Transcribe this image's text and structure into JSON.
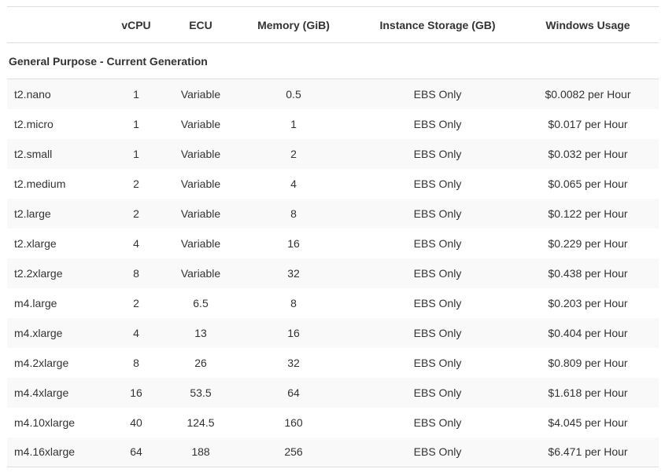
{
  "table": {
    "headers": {
      "name": "",
      "vcpu": "vCPU",
      "ecu": "ECU",
      "memory": "Memory (GiB)",
      "storage": "Instance Storage (GB)",
      "windows_usage": "Windows Usage"
    },
    "group_title": "General Purpose - Current Generation",
    "rows": [
      {
        "name": "t2.nano",
        "vcpu": "1",
        "ecu": "Variable",
        "memory": "0.5",
        "storage": "EBS Only",
        "price": "$0.0082 per Hour"
      },
      {
        "name": "t2.micro",
        "vcpu": "1",
        "ecu": "Variable",
        "memory": "1",
        "storage": "EBS Only",
        "price": "$0.017 per Hour"
      },
      {
        "name": "t2.small",
        "vcpu": "1",
        "ecu": "Variable",
        "memory": "2",
        "storage": "EBS Only",
        "price": "$0.032 per Hour"
      },
      {
        "name": "t2.medium",
        "vcpu": "2",
        "ecu": "Variable",
        "memory": "4",
        "storage": "EBS Only",
        "price": "$0.065 per Hour"
      },
      {
        "name": "t2.large",
        "vcpu": "2",
        "ecu": "Variable",
        "memory": "8",
        "storage": "EBS Only",
        "price": "$0.122 per Hour"
      },
      {
        "name": "t2.xlarge",
        "vcpu": "4",
        "ecu": "Variable",
        "memory": "16",
        "storage": "EBS Only",
        "price": "$0.229 per Hour"
      },
      {
        "name": "t2.2xlarge",
        "vcpu": "8",
        "ecu": "Variable",
        "memory": "32",
        "storage": "EBS Only",
        "price": "$0.438 per Hour"
      },
      {
        "name": "m4.large",
        "vcpu": "2",
        "ecu": "6.5",
        "memory": "8",
        "storage": "EBS Only",
        "price": "$0.203 per Hour"
      },
      {
        "name": "m4.xlarge",
        "vcpu": "4",
        "ecu": "13",
        "memory": "16",
        "storage": "EBS Only",
        "price": "$0.404 per Hour"
      },
      {
        "name": "m4.2xlarge",
        "vcpu": "8",
        "ecu": "26",
        "memory": "32",
        "storage": "EBS Only",
        "price": "$0.809 per Hour"
      },
      {
        "name": "m4.4xlarge",
        "vcpu": "16",
        "ecu": "53.5",
        "memory": "64",
        "storage": "EBS Only",
        "price": "$1.618 per Hour"
      },
      {
        "name": "m4.10xlarge",
        "vcpu": "40",
        "ecu": "124.5",
        "memory": "160",
        "storage": "EBS Only",
        "price": "$4.045 per Hour"
      },
      {
        "name": "m4.16xlarge",
        "vcpu": "64",
        "ecu": "188",
        "memory": "256",
        "storage": "EBS Only",
        "price": "$6.471 per Hour"
      }
    ]
  }
}
